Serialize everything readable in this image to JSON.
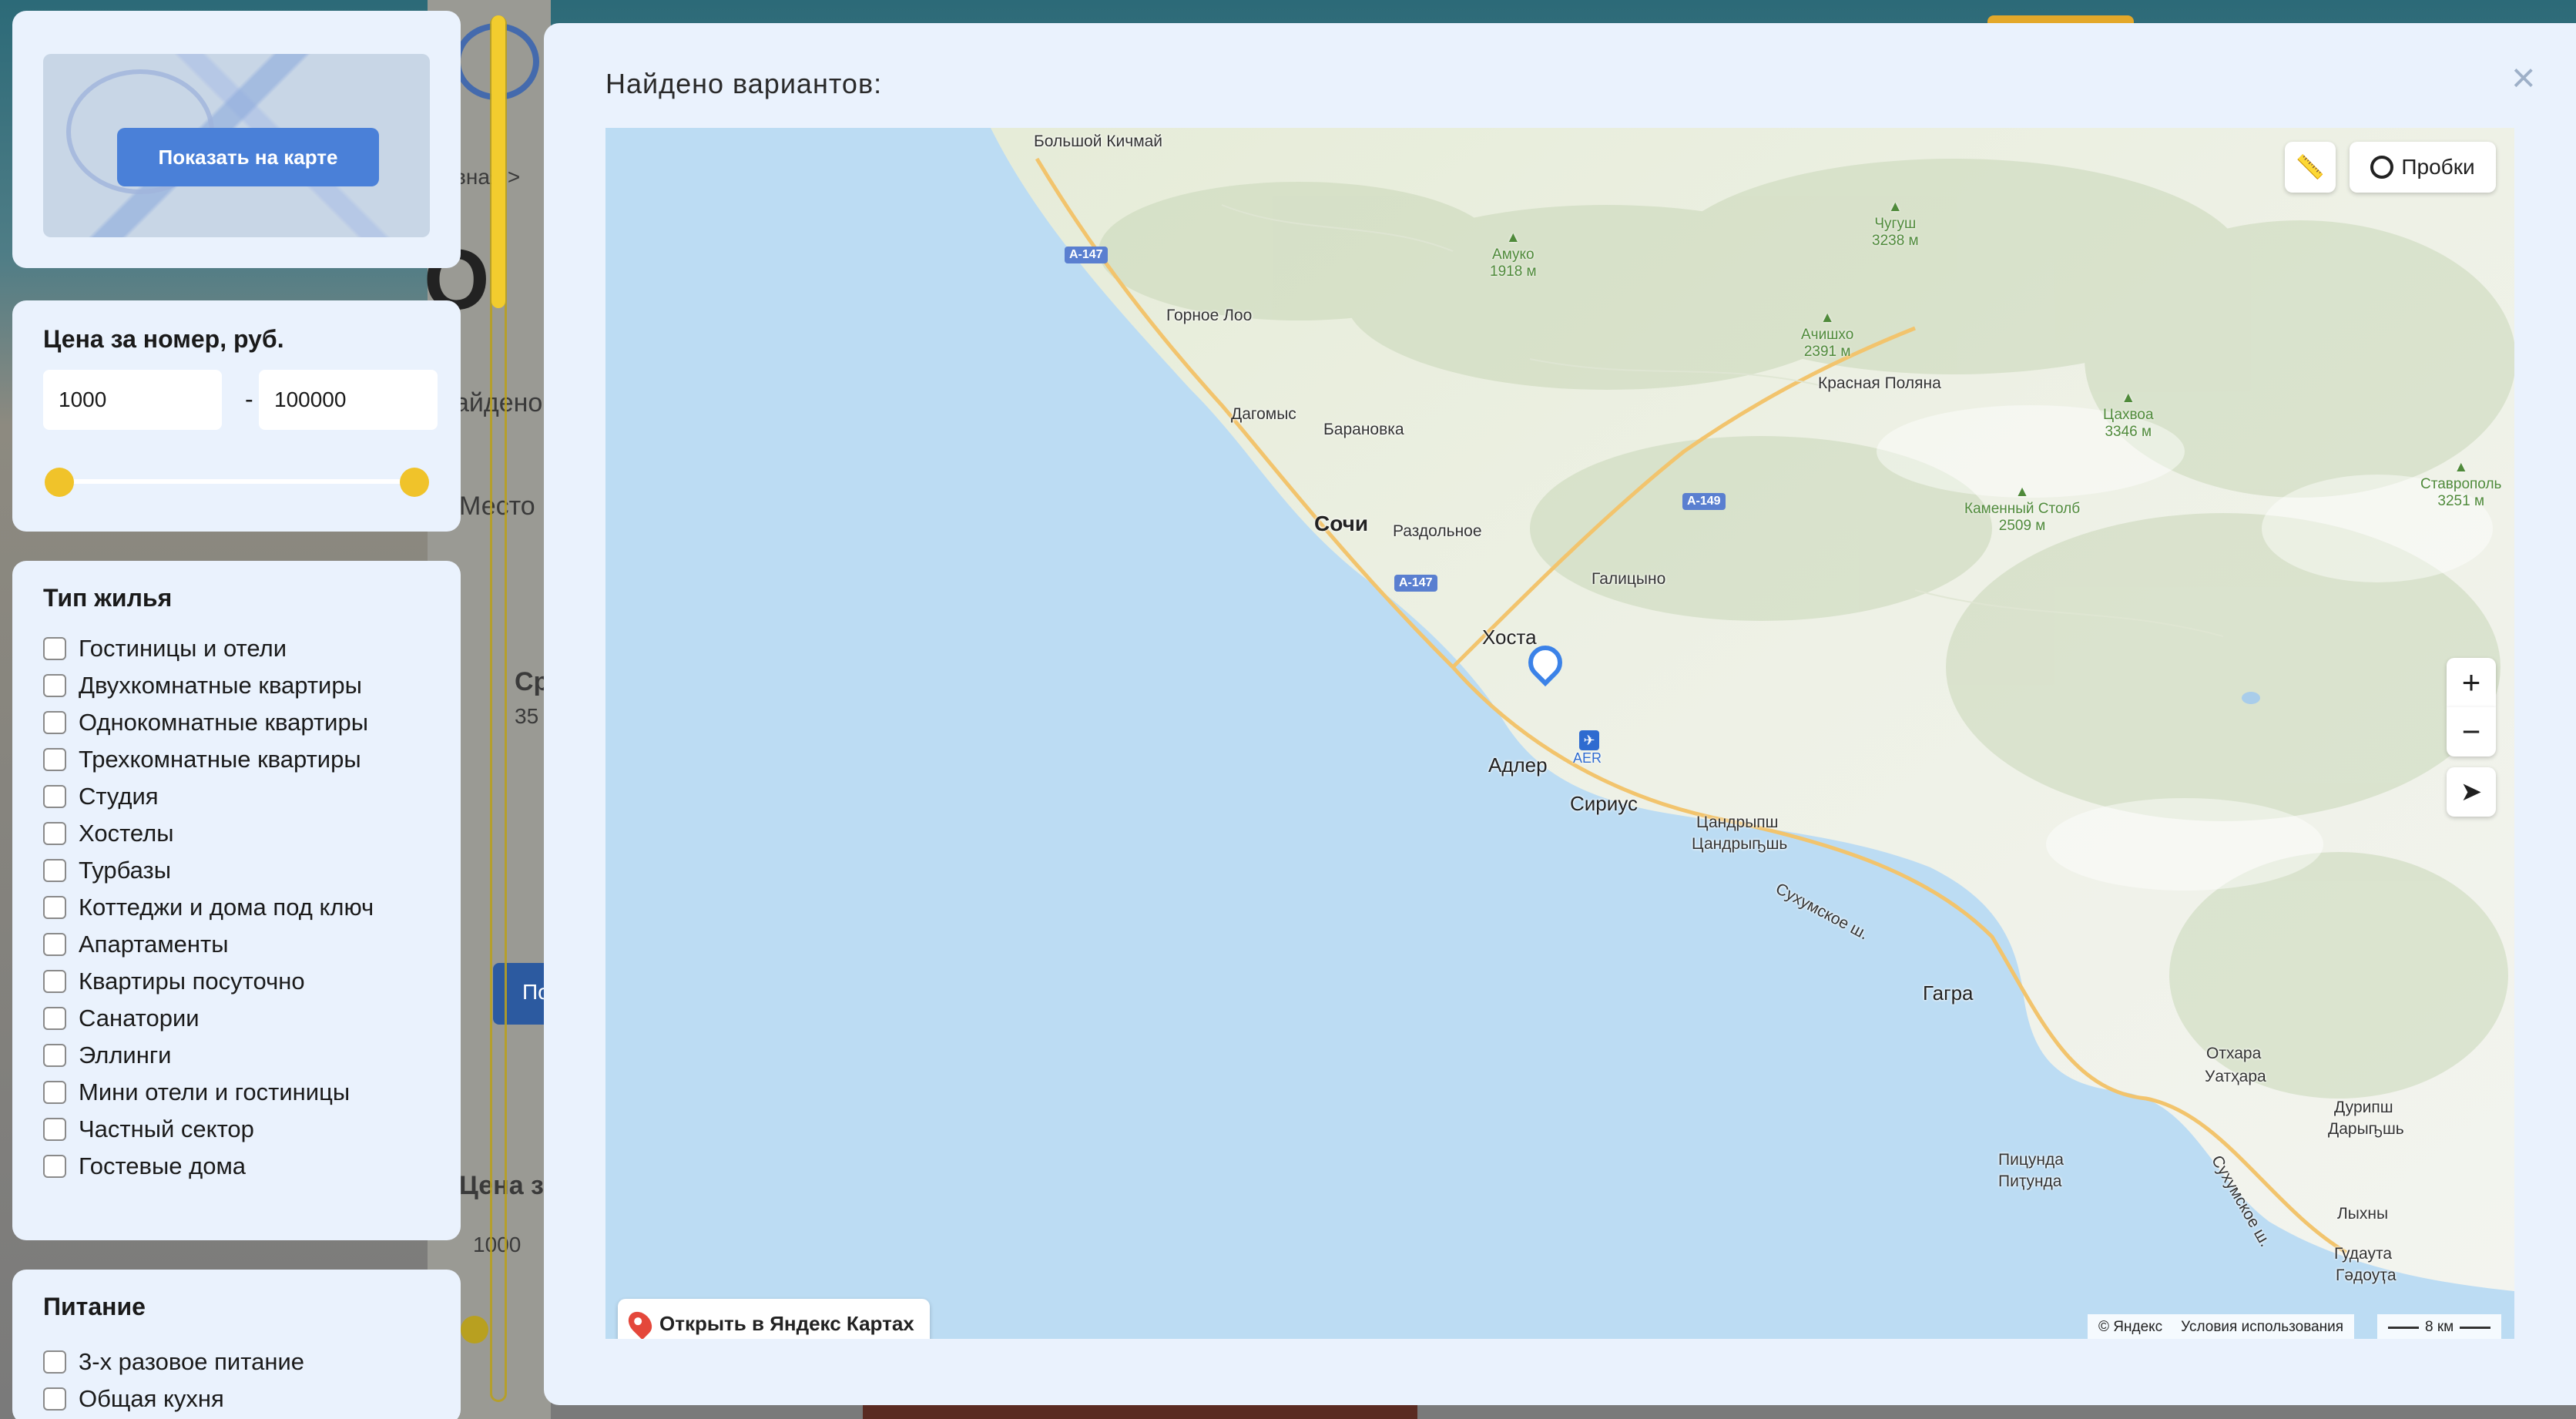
{
  "background": {
    "fragment_texts": [
      "вная >",
      "айдено",
      "Место",
      "Ср",
      "35",
      "По",
      "Цена з",
      "1000"
    ]
  },
  "filters": {
    "show_map_label": "Показать на карте",
    "price": {
      "title": "Цена за номер, руб.",
      "min": "1000",
      "max": "100000",
      "separator": "-",
      "range_fraction": [
        0.0,
        1.0
      ]
    },
    "housing": {
      "title": "Тип жилья",
      "items": [
        "Гостиницы и отели",
        "Двухкомнатные квартиры",
        "Однокомнатные квартиры",
        "Трехкомнатные квартиры",
        "Студия",
        "Хостелы",
        "Турбазы",
        "Коттеджи и дома под ключ",
        "Апартаменты",
        "Квартиры посуточно",
        "Санатории",
        "Эллинги",
        "Мини отели и гостиницы",
        "Частный сектор",
        "Гостевые дома"
      ]
    },
    "food": {
      "title": "Питание",
      "items": [
        "3-х разовое питание",
        "Общая кухня"
      ]
    }
  },
  "modal": {
    "title": "Найдено вариантов:",
    "close": "×"
  },
  "map": {
    "traffic_label": "Пробки",
    "open_in_yandex": "Открыть в Яндекс Картах",
    "copyright": "© Яндекс",
    "terms": "Условия использования",
    "scale": "8 км",
    "zoom_in": "+",
    "zoom_out": "−",
    "places": {
      "bolshoy_kichmay": "Большой Кичмай",
      "gornoe_loo": "Горное Лоо",
      "dagomys": "Дагомыс",
      "baranovka": "Барановка",
      "sochi": "Сочи",
      "razdolnoe": "Раздольное",
      "galitsyno": "Галицыно",
      "khosta": "Хоста",
      "adler": "Адлер",
      "sirius": "Сириус",
      "aer": "AER",
      "krasnaya_polyana": "Красная Поляна",
      "tsandryshp": "Цандрыпш",
      "tsandryphsh_abkh": "Цандрыҧшь",
      "sukhumskoe_1": "Сухумское ш.",
      "gagra": "Гагра",
      "otkhara": "Отхара",
      "otkhara_abkh": "Уатҳара",
      "duripsh": "Дурипш",
      "duripsh_abkh": "Дарыҧшь",
      "pitsunda": "Пицунда",
      "pitsunda_abkh": "Пиҭунда",
      "sukhumskoe_2": "Сухумское ш.",
      "lykhny": "Лыхны",
      "gudauta": "Гудаута",
      "gudauta_abkh": "Гәдоуҭа"
    },
    "peaks": [
      {
        "name": "Амуко",
        "height": "1918 м"
      },
      {
        "name": "Чугуш",
        "height": "3238 м"
      },
      {
        "name": "Ачишхо",
        "height": "2391 м"
      },
      {
        "name": "Цахвоа",
        "height": "3346 м"
      },
      {
        "name": "Каменный Столб",
        "height": "2509 м"
      },
      {
        "name": "Ставрополь",
        "height": "3251 м"
      }
    ],
    "roads": [
      "A-147",
      "A-147",
      "A-149"
    ]
  }
}
